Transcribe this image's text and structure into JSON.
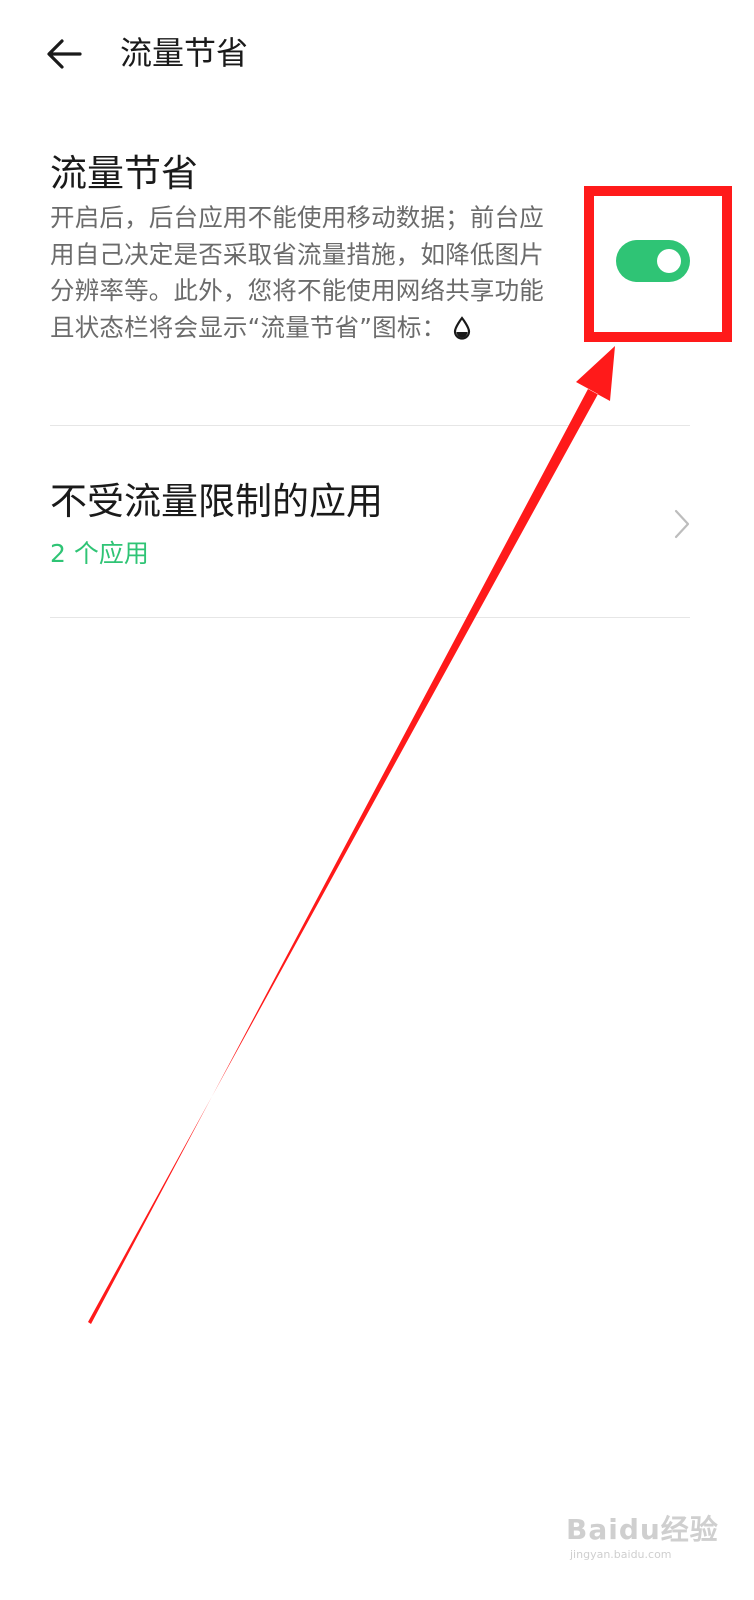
{
  "header": {
    "title": "流量节省",
    "back_icon": "arrow-left-icon"
  },
  "data_saver": {
    "title": "流量节省",
    "description": "开启后，后台应用不能使用移动数据；前台应用自己决定是否采取省流量措施，如降低图片分辨率等。此外，您将不能使用网络共享功能且状态栏将会显示“流量节省”图标：",
    "status_icon": "water-drop-icon",
    "toggle_on": true
  },
  "unrestricted_apps": {
    "title": "不受流量限制的应用",
    "subtitle": "2 个应用",
    "chevron_icon": "chevron-right-icon"
  },
  "watermark": {
    "logo_text": "Baidu经验",
    "sub_text": "jingyan.baidu.com"
  },
  "colors": {
    "accent": "#2fc475",
    "annotation": "#ff1a1a",
    "text_primary": "#1a1a1a",
    "text_secondary": "#6b6b6b"
  }
}
